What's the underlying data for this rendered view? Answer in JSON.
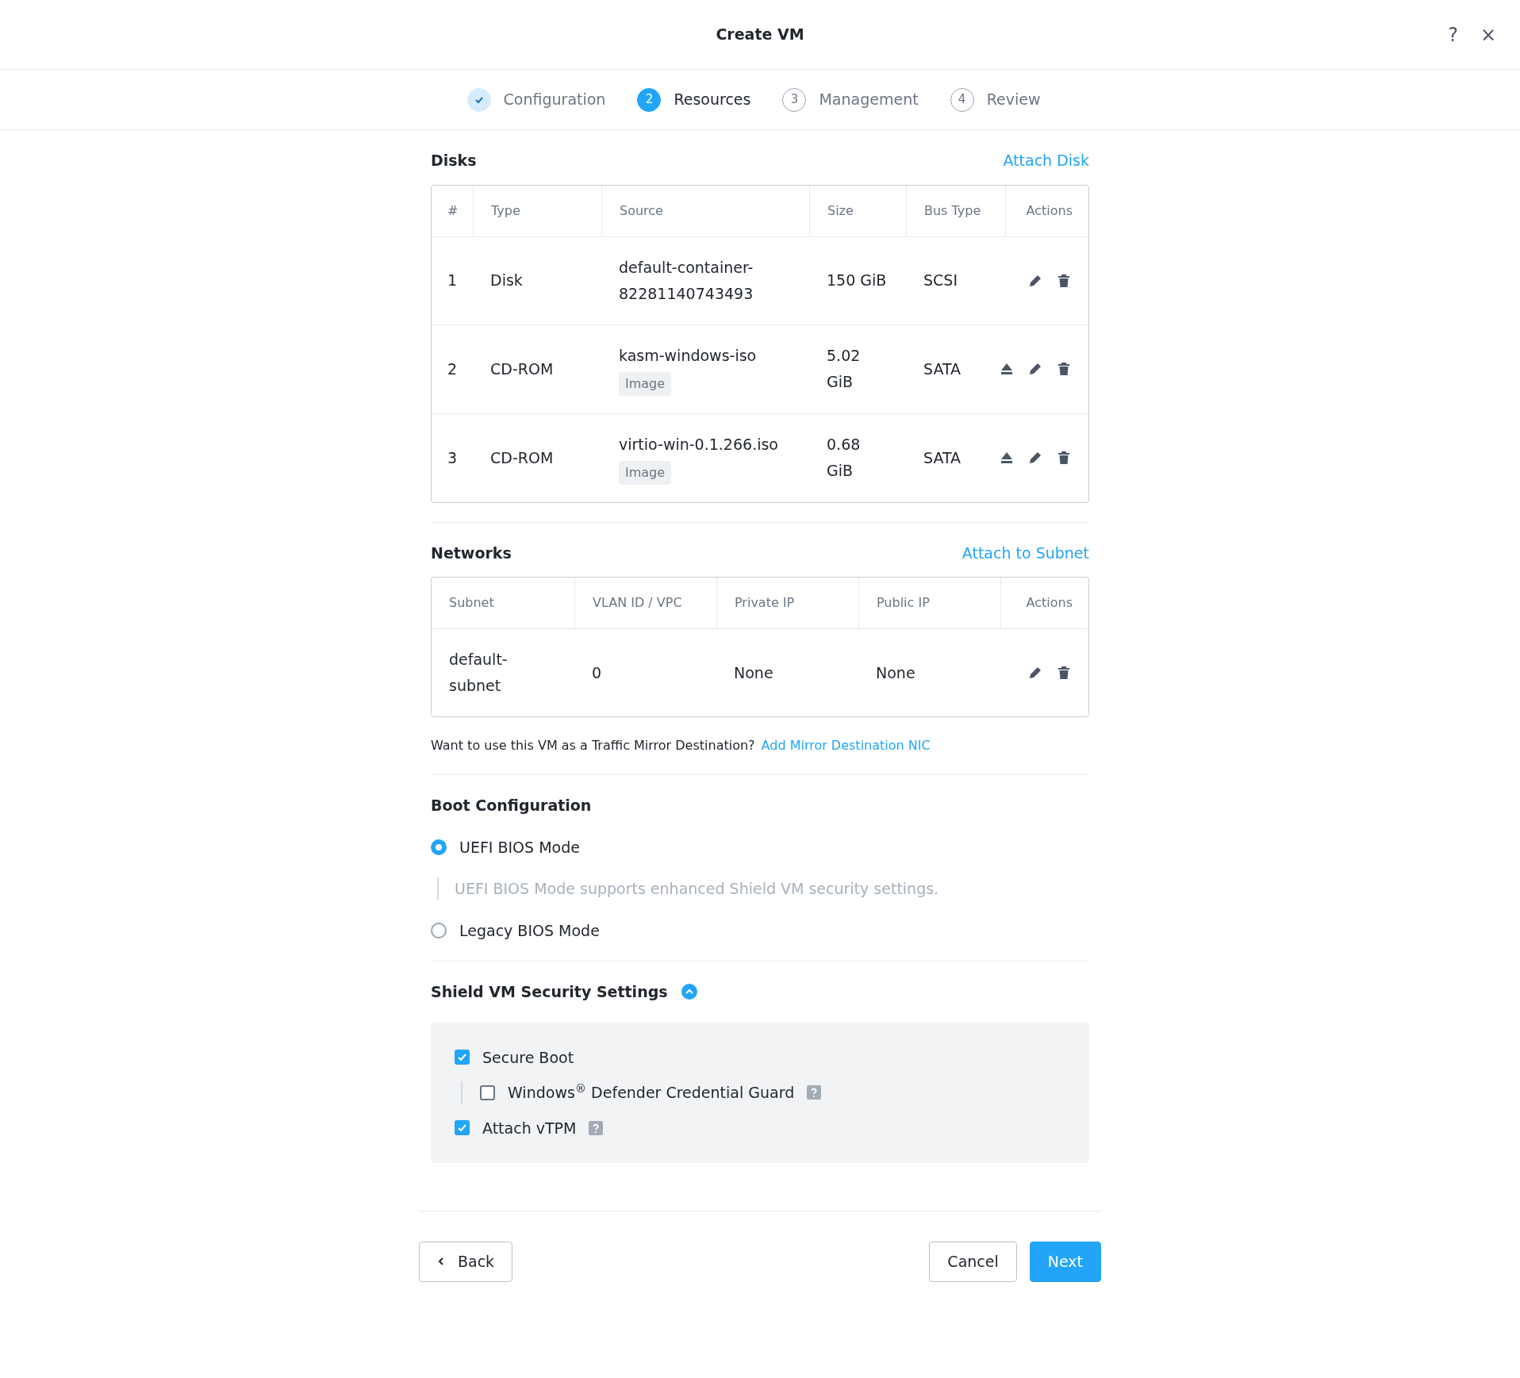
{
  "window": {
    "title": "Create VM",
    "help": "?",
    "close": "×"
  },
  "steps": [
    {
      "label": "Configuration",
      "done": true,
      "selected": false
    },
    {
      "label": "Resources",
      "number": "2",
      "done": false,
      "selected": true
    },
    {
      "label": "Management",
      "number": "3",
      "done": false,
      "selected": false
    },
    {
      "label": "Review",
      "number": "4",
      "done": false,
      "selected": false
    }
  ],
  "disks": {
    "title": "Disks",
    "action": "Attach Disk",
    "columns": [
      "#",
      "Type",
      "Source",
      "Size",
      "Bus Type",
      "Actions"
    ],
    "rows": [
      {
        "number": "1",
        "type": "Disk",
        "source": "default-container-82281140743493",
        "size": "150 GiB",
        "bus_type": "SCSI",
        "actions": [
          {
            "kind": "edit"
          },
          {
            "kind": "delete"
          }
        ]
      },
      {
        "number": "2",
        "type": "CD-ROM",
        "source": "kasm-windows-iso",
        "tag": "Image",
        "size": "5.02 GiB",
        "bus_type": "SATA",
        "actions": [
          {
            "kind": "eject"
          },
          {
            "kind": "edit"
          },
          {
            "kind": "delete"
          }
        ]
      },
      {
        "number": "3",
        "type": "CD-ROM",
        "source": "virtio-win-0.1.266.iso",
        "tag": "Image",
        "size": "0.68 GiB",
        "bus_type": "SATA",
        "actions": [
          {
            "kind": "eject"
          },
          {
            "kind": "edit"
          },
          {
            "kind": "delete"
          }
        ]
      }
    ]
  },
  "networks": {
    "title": "Networks",
    "action": "Attach to Subnet",
    "columns": [
      "Subnet",
      "VLAN ID / VPC",
      "Private IP",
      "Public IP",
      "Actions"
    ],
    "rows": [
      {
        "subnet": "default-subnet",
        "vlan": "0",
        "private_ip": "None",
        "public_ip": "None",
        "actions": [
          {
            "kind": "edit"
          },
          {
            "kind": "delete"
          }
        ]
      }
    ],
    "mirror_prompt": "Want to use this VM as a Traffic Mirror Destination?",
    "mirror_link": "Add Mirror Destination NIC"
  },
  "boot": {
    "title": "Boot Configuration",
    "options": [
      {
        "label": "UEFI BIOS Mode",
        "selected": true,
        "note": "UEFI BIOS Mode supports enhanced Shield VM security settings."
      },
      {
        "label": "Legacy BIOS Mode",
        "selected": false
      }
    ]
  },
  "shield": {
    "title": "Shield VM Security Settings",
    "expanded": true,
    "settings": [
      {
        "label": "Secure Boot",
        "checked": true,
        "children": [
          {
            "label": "Windows$^{®}$ Defender Credential Guard",
            "checked": false,
            "help": true
          }
        ]
      },
      {
        "label": "Attach vTPM",
        "checked": true,
        "help": true
      }
    ]
  },
  "footer": {
    "back": "Back",
    "cancel": "Cancel",
    "next": "Next"
  }
}
